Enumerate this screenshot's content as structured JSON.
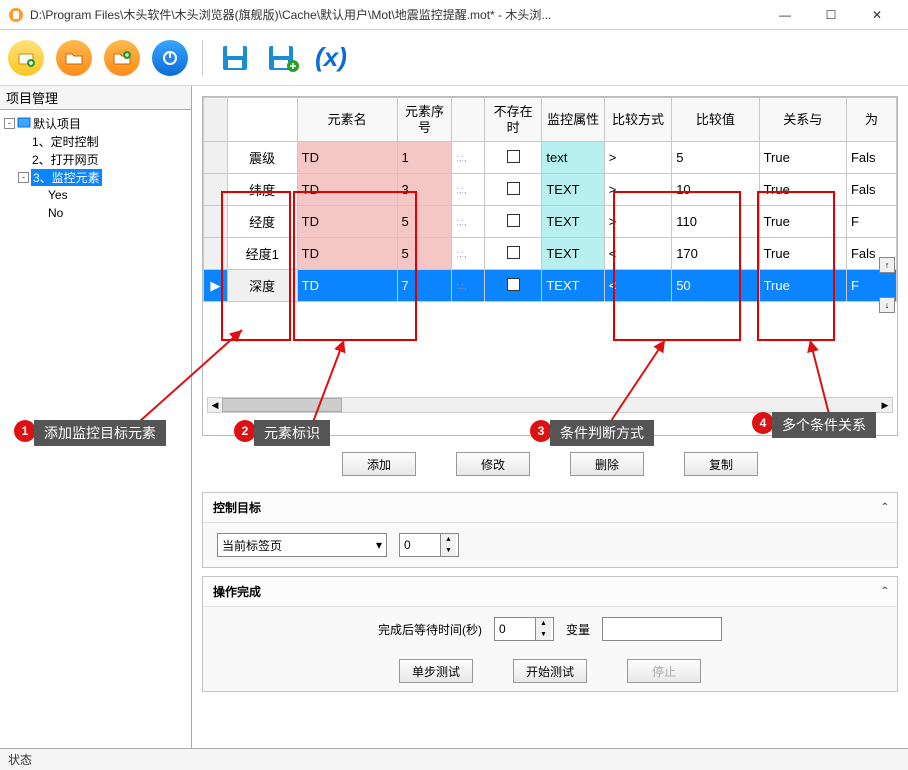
{
  "window": {
    "title": "D:\\Program Files\\木头软件\\木头浏览器(旗舰版)\\Cache\\默认用户\\Mot\\地震监控提醒.mot* - 木头浏..."
  },
  "sidebar": {
    "title": "项目管理",
    "root": "默认项目",
    "items": [
      "1、定时控制",
      "2、打开网页",
      "3、监控元素"
    ],
    "children": [
      "Yes",
      "No"
    ]
  },
  "table": {
    "headers": [
      "元素名",
      "元素序号",
      "",
      "不存在时",
      "监控属性",
      "比较方式",
      "比较值",
      "关系与",
      "为"
    ],
    "rows": [
      {
        "name": "震级",
        "elem": "TD",
        "idx": "1",
        "mon": "text",
        "op": ">",
        "val": "5",
        "rel": "True",
        "tail": "Fals"
      },
      {
        "name": "纬度",
        "elem": "TD",
        "idx": "3",
        "mon": "TEXT",
        "op": ">",
        "val": "10",
        "rel": "True",
        "tail": "Fals"
      },
      {
        "name": "经度",
        "elem": "TD",
        "idx": "5",
        "mon": "TEXT",
        "op": ">",
        "val": "110",
        "rel": "True",
        "tail": "F"
      },
      {
        "name": "经度1",
        "elem": "TD",
        "idx": "5",
        "mon": "TEXT",
        "op": "<",
        "val": "170",
        "rel": "True",
        "tail": "Fals"
      },
      {
        "name": "深度",
        "elem": "TD",
        "idx": "7",
        "mon": "TEXT",
        "op": "<",
        "val": "50",
        "rel": "True",
        "tail": "F"
      }
    ],
    "buttons": {
      "add": "添加",
      "modify": "修改",
      "delete": "删除",
      "copy": "复制"
    }
  },
  "control_target": {
    "title": "控制目标",
    "tab_option": "当前标签页",
    "index": "0"
  },
  "operation": {
    "title": "操作完成",
    "wait_label": "完成后等待时间(秒)",
    "wait_value": "0",
    "var_label": "变量",
    "buttons": {
      "step": "单步测试",
      "start": "开始测试",
      "stop": "停止"
    }
  },
  "status": {
    "label": "状态"
  },
  "annotations": {
    "a1": "添加监控目标元素",
    "a2": "元素标识",
    "a3": "条件判断方式",
    "a4": "多个条件关系"
  },
  "icons": {
    "minimize": "—",
    "maximize": "☐",
    "close": "✕",
    "dropdown": "▾",
    "collapse": "-",
    "expand_up": "˄",
    "expand_down": "˅"
  }
}
